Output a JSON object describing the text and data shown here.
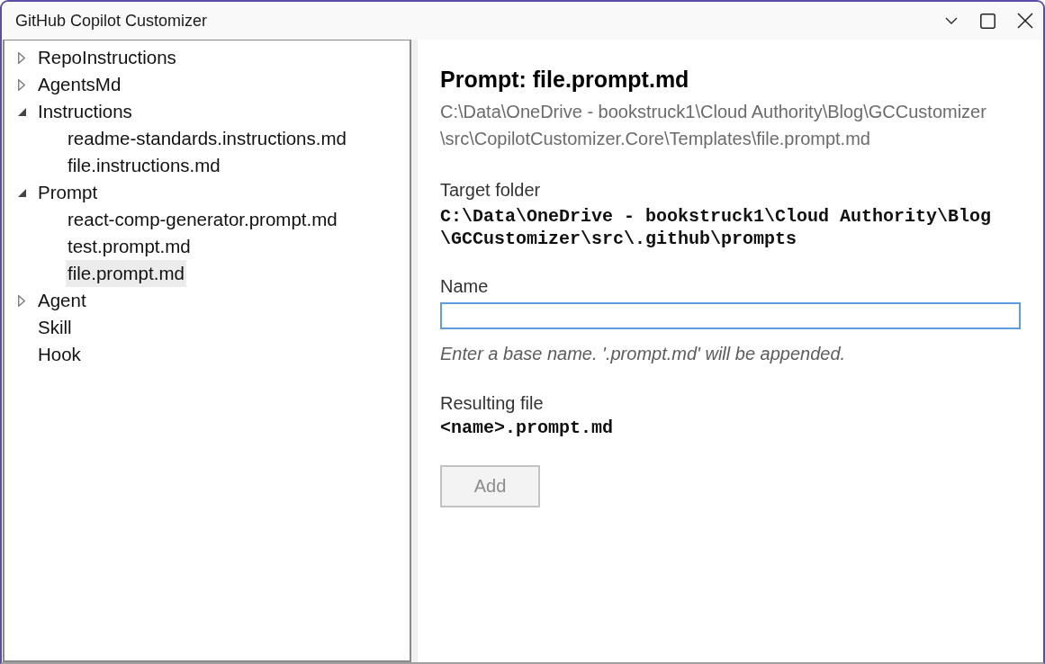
{
  "window": {
    "title": "GitHub Copilot Customizer"
  },
  "tree": [
    {
      "kind": "group",
      "label": "RepoInstructions",
      "expanded": false,
      "selected": false
    },
    {
      "kind": "group",
      "label": "AgentsMd",
      "expanded": false,
      "selected": false
    },
    {
      "kind": "group",
      "label": "Instructions",
      "expanded": true,
      "selected": false,
      "children": [
        {
          "kind": "item",
          "label": "readme-standards.instructions.md",
          "selected": false
        },
        {
          "kind": "item",
          "label": "file.instructions.md",
          "selected": false
        }
      ]
    },
    {
      "kind": "group",
      "label": "Prompt",
      "expanded": true,
      "selected": false,
      "children": [
        {
          "kind": "item",
          "label": "react-comp-generator.prompt.md",
          "selected": false
        },
        {
          "kind": "item",
          "label": "test.prompt.md",
          "selected": false
        },
        {
          "kind": "item",
          "label": "file.prompt.md",
          "selected": true
        }
      ]
    },
    {
      "kind": "group",
      "label": "Agent",
      "expanded": false,
      "selected": false
    },
    {
      "kind": "item",
      "label": "Skill",
      "selected": false
    },
    {
      "kind": "item",
      "label": "Hook",
      "selected": false
    }
  ],
  "detail": {
    "title": "Prompt: file.prompt.md",
    "source_path": [
      "C:\\Data\\OneDrive - bookstruck1\\Cloud Authority\\Blog\\GCCustomizer",
      "\\src\\CopilotCustomizer.Core\\Templates\\file.prompt.md"
    ],
    "target_folder": {
      "label": "Target folder",
      "value": [
        "C:\\Data\\OneDrive - bookstruck1\\Cloud Authority\\Blog",
        "\\GCCustomizer\\src\\.github\\prompts"
      ]
    },
    "name": {
      "label": "Name",
      "focused": true,
      "hint": "Enter a base name. '.prompt.md' will be appended."
    },
    "resulting_file": {
      "label": "Resulting file",
      "value": "<name>.prompt.md"
    },
    "add_button": {
      "label": "Add",
      "disabled": true
    }
  }
}
